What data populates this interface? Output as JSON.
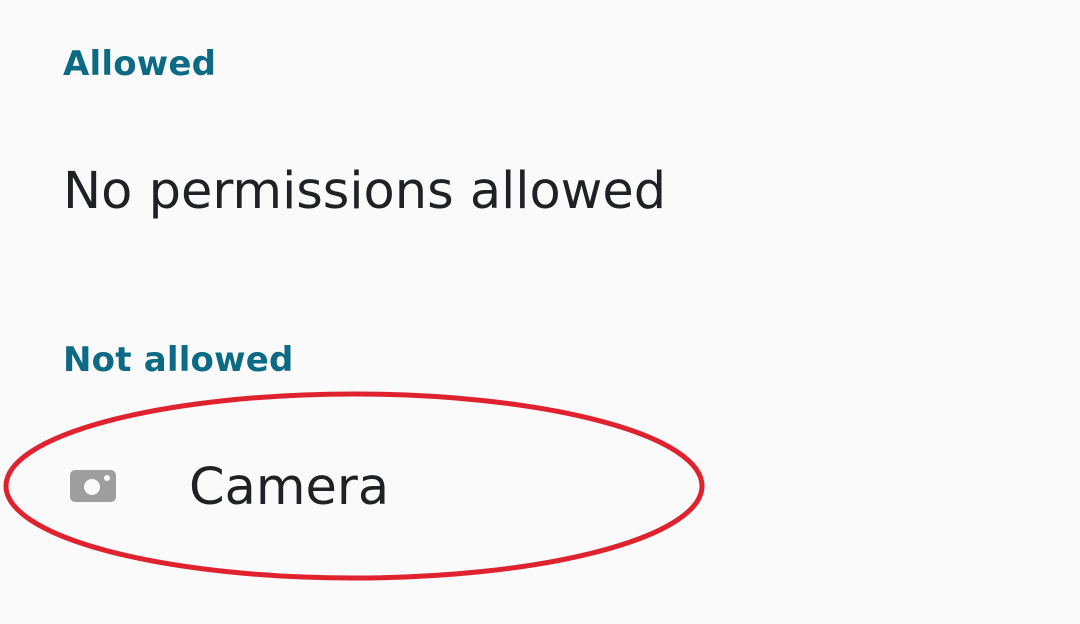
{
  "sections": {
    "allowed": {
      "header": "Allowed",
      "empty_text": "No permissions allowed"
    },
    "not_allowed": {
      "header": "Not allowed",
      "items": [
        {
          "label": "Camera",
          "icon": "camera-icon"
        }
      ]
    }
  },
  "colors": {
    "background": "#fafafa",
    "section_header": "#0b6a84",
    "primary_text": "#202124",
    "icon": "#9e9e9e",
    "annotation": "#e0222e"
  }
}
